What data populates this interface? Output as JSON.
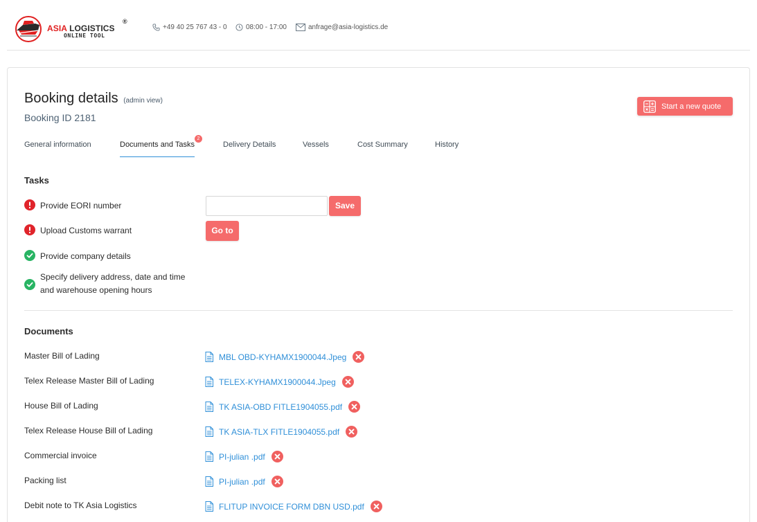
{
  "header": {
    "brand_top_red": "ASIA",
    "brand_top_dark": "LOGISTICS",
    "brand_reg": "®",
    "brand_sub": "ONLINE TOOL",
    "phone": "+49 40 25 767 43 - 0",
    "hours": "08:00 - 17:00",
    "email": "anfrage@asia-logistics.de",
    "icons": [
      "phone-icon",
      "clock-icon",
      "mail-icon"
    ]
  },
  "page": {
    "title": "Booking details",
    "title_sub": "(admin view)",
    "booking_id": "Booking ID 2181",
    "new_quote_label": "Start a new quote"
  },
  "tabs": [
    {
      "label": "General information"
    },
    {
      "label": "Documents and Tasks",
      "badge": "2",
      "active": true
    },
    {
      "label": "Delivery Details"
    },
    {
      "label": "Vessels"
    },
    {
      "label": "Cost Summary"
    },
    {
      "label": "History"
    }
  ],
  "tasks": {
    "title": "Tasks",
    "items": [
      {
        "text": "Provide EORI number",
        "status": "open"
      },
      {
        "text": "Upload Customs warrant",
        "status": "open"
      },
      {
        "text": "Provide company details",
        "status": "done"
      },
      {
        "text": "Specify delivery address, date and time and warehouse opening hours",
        "status": "done"
      }
    ],
    "eori_value": "",
    "save_label": "Save",
    "goto_label": "Go to"
  },
  "documents": {
    "title": "Documents",
    "items": [
      {
        "label": "Master Bill of Lading",
        "file": "MBL OBD-KYHAMX1900044.Jpeg"
      },
      {
        "label": "Telex Release Master Bill of Lading",
        "file": "TELEX-KYHAMX1900044.Jpeg"
      },
      {
        "label": "House Bill of Lading",
        "file": "TK ASIA-OBD FITLE1904055.pdf"
      },
      {
        "label": "Telex Release House Bill of Lading",
        "file": "TK ASIA-TLX FITLE1904055.pdf"
      },
      {
        "label": "Commercial invoice",
        "file": "PI-julian .pdf"
      },
      {
        "label": "Packing list",
        "file": "PI-julian .pdf"
      },
      {
        "label": "Debit note to TK Asia Logistics",
        "file": "FLITUP INVOICE FORM DBN USD.pdf"
      }
    ]
  },
  "colors": {
    "accent": "#f56b6b",
    "link": "#2f8fd8",
    "error": "#e0242b",
    "success": "#28b463",
    "brand_red": "#e02020"
  }
}
